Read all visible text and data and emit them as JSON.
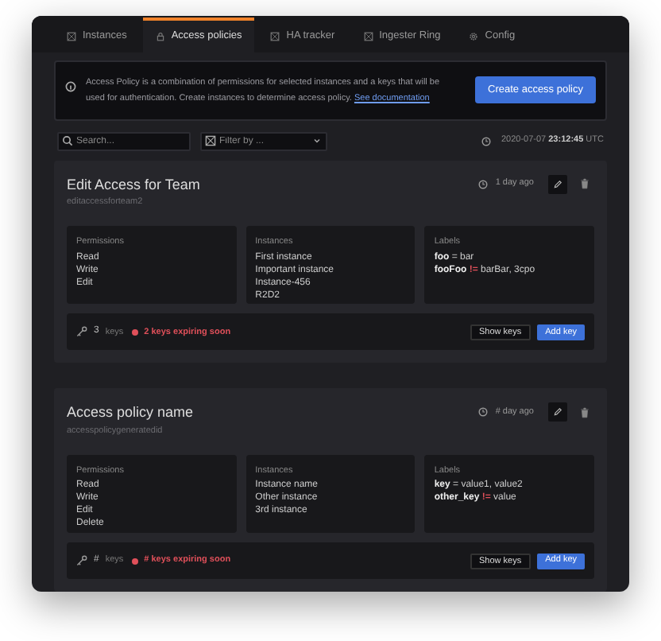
{
  "tabs": [
    {
      "label": "Instances",
      "selected": false
    },
    {
      "label": "Access policies",
      "selected": true
    },
    {
      "label": "HA tracker",
      "selected": false
    },
    {
      "label": "Ingester Ring",
      "selected": false
    },
    {
      "label": "Config",
      "selected": false
    }
  ],
  "banner": {
    "text": "Access Policy is a combination of permissions for selected instances and a keys that will be used for authentication. Create instances to determine access policy.",
    "link": "See documentation",
    "button": "Create access policy"
  },
  "toolbar": {
    "search_placeholder": "Search...",
    "filter_placeholder": "Filter by ...",
    "date": "2020-07-07",
    "time": "23:12:45",
    "zone": "UTC"
  },
  "policies": [
    {
      "title": "Edit Access for Team",
      "id": "editaccessforteam2",
      "updated": "1 day ago",
      "permissions_heading": "Permissions",
      "permissions": [
        "Read",
        "Write",
        "Edit"
      ],
      "instances_heading": "Instances",
      "instances": [
        "First instance",
        "Important instance",
        "Instance-456",
        "R2D2"
      ],
      "labels_heading": "Labels",
      "labels": [
        {
          "key": "foo",
          "op": "=",
          "value": "bar"
        },
        {
          "key": "fooFoo",
          "op": "!=",
          "value": "barBar, 3cpo"
        }
      ],
      "key_count": "3",
      "keys_label": "keys",
      "expiring": "2 keys expiring soon",
      "show_button": "Show keys",
      "add_button": "Add key"
    },
    {
      "title": "Access policy name",
      "id": "accesspolicygeneratedid",
      "updated": "# day ago",
      "permissions_heading": "Permissions",
      "permissions": [
        "Read",
        "Write",
        "Edit",
        "Delete"
      ],
      "instances_heading": "Instances",
      "instances": [
        "Instance name",
        "Other instance",
        "3rd instance"
      ],
      "labels_heading": "Labels",
      "labels": [
        {
          "key": "key",
          "op": "=",
          "value": "value1, value2"
        },
        {
          "key": "other_key",
          "op": "!=",
          "value": "value"
        }
      ],
      "key_count": "#",
      "keys_label": "keys",
      "expiring": "# keys expiring soon",
      "show_button": "Show keys",
      "add_button": "Add key"
    }
  ]
}
